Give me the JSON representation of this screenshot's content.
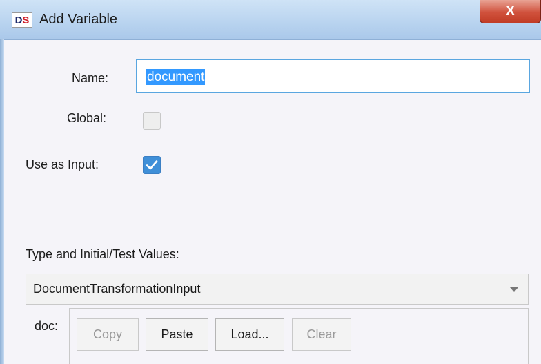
{
  "window": {
    "icon_text_d": "D",
    "icon_text_s": "S",
    "title": "Add Variable",
    "close_glyph": "X"
  },
  "form": {
    "name_label": "Name:",
    "name_value": "document",
    "global_label": "Global:",
    "global_checked": false,
    "use_as_input_label": "Use as Input:",
    "use_as_input_checked": true,
    "type_section_label": "Type and Initial/Test Values:",
    "type_selected": "DocumentTransformationInput",
    "doc_label": "doc:"
  },
  "buttons": {
    "copy": "Copy",
    "paste": "Paste",
    "load": "Load...",
    "clear": "Clear"
  },
  "colors": {
    "selection": "#3399ff",
    "checkbox_checked": "#3f8fd8",
    "close_button": "#c13c25"
  }
}
